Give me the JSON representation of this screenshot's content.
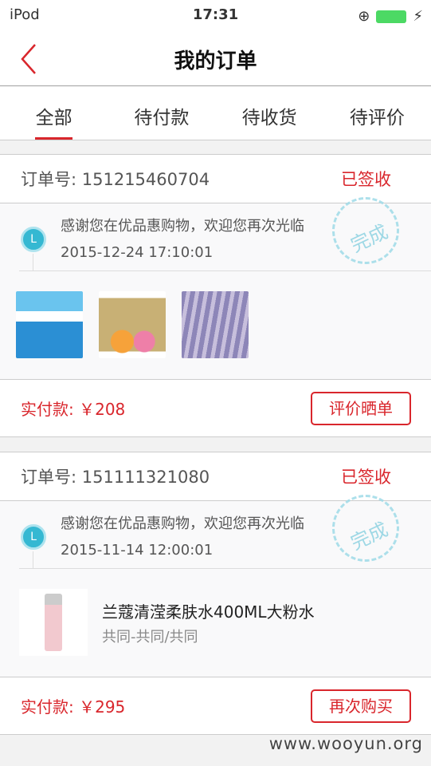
{
  "status_bar": {
    "device": "iPod",
    "time": "17:31"
  },
  "nav": {
    "title": "我的订单"
  },
  "tabs": [
    {
      "label": "全部"
    },
    {
      "label": "待付款"
    },
    {
      "label": "待收货"
    },
    {
      "label": "待评价"
    }
  ],
  "orders": [
    {
      "order_no": "订单号: 151215460704",
      "status": "已签收",
      "message": "感谢您在优品惠购物，欢迎您再次光临",
      "time": "2015-12-24 17:10:01",
      "stamp": "完成",
      "paid": "实付款: ￥208",
      "action": "评价晒单"
    },
    {
      "order_no": "订单号: 151111321080",
      "status": "已签收",
      "message": "感谢您在优品惠购物，欢迎您再次光临",
      "time": "2015-11-14 12:00:01",
      "stamp": "完成",
      "product_name": "兰蔻清滢柔肤水400ML大粉水",
      "product_variant": "共同-共同/共同",
      "paid": "实付款: ￥295",
      "action": "再次购买"
    }
  ],
  "watermark": "www.wooyun.org",
  "colors": {
    "accent": "#d9262c",
    "clock": "#35b8d2"
  }
}
